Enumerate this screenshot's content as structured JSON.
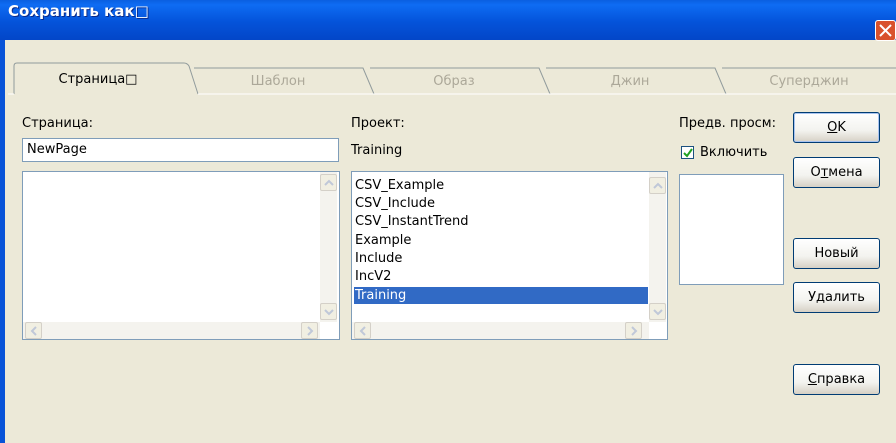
{
  "window": {
    "title": "Сохранить как□"
  },
  "tabs": [
    {
      "label": "Страница□",
      "active": true
    },
    {
      "label": "Шаблон",
      "active": false
    },
    {
      "label": "Образ",
      "active": false
    },
    {
      "label": "Джин",
      "active": false
    },
    {
      "label": "Суперджин",
      "active": false
    }
  ],
  "page": {
    "label": "Страница:",
    "value": "NewPage"
  },
  "project": {
    "label": "Проект:",
    "current": "Training",
    "items": [
      "CSV_Example",
      "CSV_Include",
      "CSV_InstantTrend",
      "Example",
      "Include",
      "IncV2",
      "Training"
    ],
    "selected_index": 6
  },
  "preview": {
    "label": "Предв. просм:",
    "checkbox_label": "Включить",
    "checked": true
  },
  "buttons": {
    "ok": {
      "underline": "O",
      "rest": "K"
    },
    "cancel": {
      "pre": "О",
      "underline": "т",
      "rest": "мена"
    },
    "new": "Новый",
    "delete": "Удалить",
    "help": {
      "underline": "С",
      "rest": "правка"
    }
  },
  "colors": {
    "titlebar": "#0453DA",
    "selection": "#316AC5",
    "dialog_bg": "#ECE9D8",
    "close_button": "#D9512C"
  }
}
